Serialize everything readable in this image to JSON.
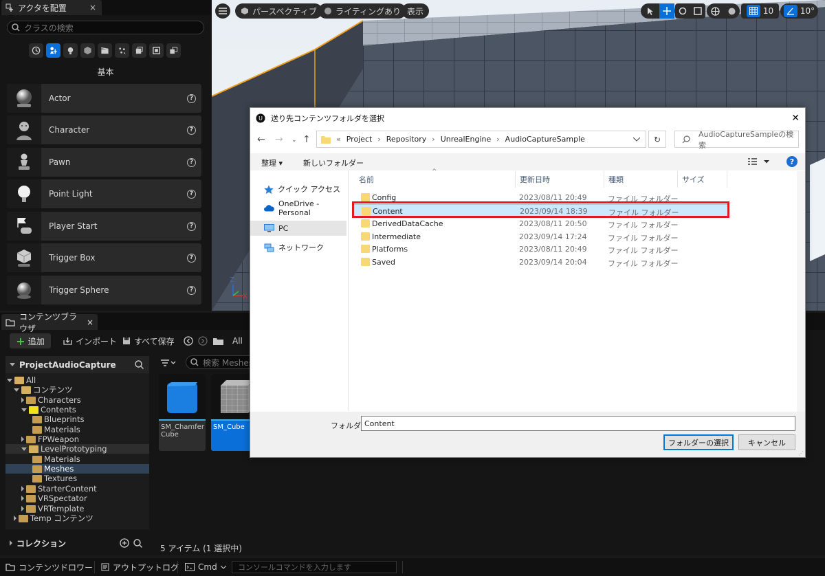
{
  "place_actors": {
    "tab_title": "アクタを配置",
    "close": "×",
    "search_placeholder": "クラスの検索",
    "category_label": "基本",
    "actors": [
      {
        "name": "Actor",
        "icon": "sphere-icon"
      },
      {
        "name": "Character",
        "icon": "character-icon"
      },
      {
        "name": "Pawn",
        "icon": "pawn-icon"
      },
      {
        "name": "Point Light",
        "icon": "lightbulb-icon"
      },
      {
        "name": "Player Start",
        "icon": "flag-gamepad-icon"
      },
      {
        "name": "Trigger Box",
        "icon": "box-icon"
      },
      {
        "name": "Trigger Sphere",
        "icon": "sphere-icon"
      }
    ],
    "help_glyph": "?"
  },
  "viewport": {
    "perspective": "パースペクティブ",
    "lighting": "ライティングあり",
    "show": "表示",
    "grid_snap": "10",
    "rotation_snap": "10°",
    "axis_z": "Z",
    "axis_x": "X"
  },
  "content_browser": {
    "tab_title": "コンテンツブラウザ",
    "close": "×",
    "add": "追加",
    "import": "インポート",
    "save_all": "すべて保存",
    "path_all": "All",
    "search_placeholder": "検索 Meshes",
    "project": "ProjectAudioCapture",
    "tree": [
      {
        "label": "All",
        "level": 0,
        "open": true
      },
      {
        "label": "コンテンツ",
        "level": 1,
        "open": true
      },
      {
        "label": "Characters",
        "level": 2,
        "open": false
      },
      {
        "label": "Contents",
        "level": 2,
        "open": true
      },
      {
        "label": "Blueprints",
        "level": 3,
        "open": false
      },
      {
        "label": "Materials",
        "level": 3,
        "open": false
      },
      {
        "label": "FPWeapon",
        "level": 2,
        "open": false
      },
      {
        "label": "LevelPrototyping",
        "level": 2,
        "open": true
      },
      {
        "label": "Materials",
        "level": 3,
        "open": false
      },
      {
        "label": "Meshes",
        "level": 3,
        "open": false
      },
      {
        "label": "Textures",
        "level": 3,
        "open": false
      },
      {
        "label": "StarterContent",
        "level": 2,
        "open": false
      },
      {
        "label": "VRSpectator",
        "level": 2,
        "open": false
      },
      {
        "label": "VRTemplate",
        "level": 2,
        "open": false
      },
      {
        "label": "Temp コンテンツ",
        "level": 1,
        "open": false
      }
    ],
    "collection": "コレクション",
    "assets": [
      {
        "name": "SM_Chamfer Cube",
        "selected": false,
        "color": "#1a7fe0"
      },
      {
        "name": "SM_Cube",
        "selected": true,
        "color": "#8c8c8c"
      }
    ],
    "status": "5 アイテム (1 選択中)"
  },
  "bottom_bar": {
    "content_drawer": "コンテンツドロワー",
    "output_log": "アウトプットログ",
    "cmd": "Cmd",
    "console_placeholder": "コンソールコマンドを入力します"
  },
  "dialog": {
    "title": "送り先コンテンツフォルダを選択",
    "close": "✕",
    "breadcrumb_prefix": "«",
    "breadcrumb": [
      "Project",
      "Repository",
      "UnrealEngine",
      "AudioCaptureSample"
    ],
    "search_placeholder": "AudioCaptureSampleの検索",
    "organize": "整理 ▾",
    "new_folder": "新しいフォルダー",
    "nav": [
      "クイック アクセス",
      "OneDrive - Personal",
      "PC",
      "ネットワーク"
    ],
    "nav_selected": "PC",
    "columns": [
      "名前",
      "更新日時",
      "種類",
      "サイズ"
    ],
    "files": [
      {
        "name": "Config",
        "date": "2023/08/11 20:49",
        "type": "ファイル フォルダー"
      },
      {
        "name": "Content",
        "date": "2023/09/14 18:39",
        "type": "ファイル フォルダー"
      },
      {
        "name": "DerivedDataCache",
        "date": "2023/08/11 20:50",
        "type": "ファイル フォルダー"
      },
      {
        "name": "Intermediate",
        "date": "2023/09/14 17:24",
        "type": "ファイル フォルダー"
      },
      {
        "name": "Platforms",
        "date": "2023/08/11 20:49",
        "type": "ファイル フォルダー"
      },
      {
        "name": "Saved",
        "date": "2023/09/14 20:04",
        "type": "ファイル フォルダー"
      }
    ],
    "selected_file": "Content",
    "folder_label": "フォルダー:",
    "folder_value": "Content",
    "select_button": "フォルダーの選択",
    "cancel_button": "キャンセル"
  },
  "colors": {
    "accent": "#0b6fd9",
    "highlight": "#e01a22",
    "selection": "#cce8ff"
  }
}
